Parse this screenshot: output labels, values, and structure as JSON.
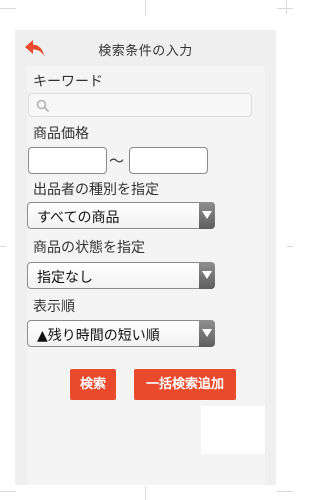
{
  "header": {
    "title": "検索条件の入力",
    "back_icon": "back-arrow-icon",
    "accent": "#e84a2b"
  },
  "keyword": {
    "label": "キーワード",
    "value": "",
    "placeholder": ""
  },
  "price": {
    "label": "商品価格",
    "separator": "〜",
    "min_value": "",
    "max_value": ""
  },
  "seller_type": {
    "label": "出品者の種別を指定",
    "selected": "すべての商品"
  },
  "condition": {
    "label": "商品の状態を指定",
    "selected": "指定なし"
  },
  "sort": {
    "label": "表示順",
    "selected": "▲残り時間の短い順"
  },
  "actions": {
    "search_label": "検索",
    "bulk_search_label": "一括検索追加"
  }
}
